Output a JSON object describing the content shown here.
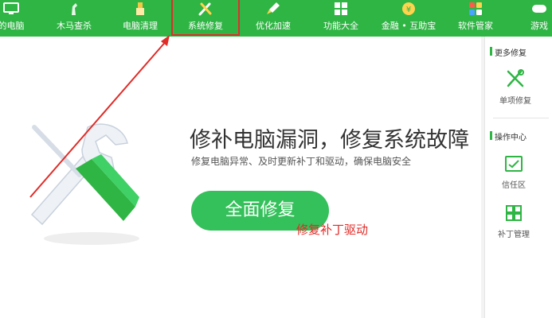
{
  "nav": {
    "items": [
      {
        "label": "的电脑"
      },
      {
        "label": "木马查杀"
      },
      {
        "label": "电脑清理"
      },
      {
        "label": "系统修复"
      },
      {
        "label": "优化加速"
      },
      {
        "label": "功能大全"
      },
      {
        "label": "金融 • 互助宝"
      },
      {
        "label": "软件管家"
      },
      {
        "label": "游戏"
      }
    ],
    "active": "系统修复"
  },
  "main": {
    "headline": "修补电脑漏洞，修复系统故障",
    "subline": "修复电脑异常、及时更新补丁和驱动，确保电脑安全",
    "repair_button": "全面修复",
    "annotation": "修复补丁驱动"
  },
  "sidebar": {
    "more_title": "更多修复",
    "single_repair": "单项修复",
    "ops_title": "操作中心",
    "trust_zone": "信任区",
    "patch_manage": "补丁管理"
  },
  "colors": {
    "brand_green": "#2fb544",
    "button_green": "#34c05a",
    "annotation_red": "#e02b27"
  }
}
